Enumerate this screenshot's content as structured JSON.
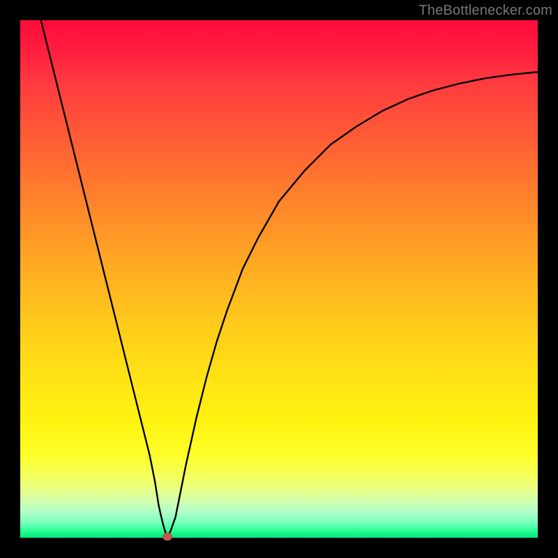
{
  "attribution": "TheBottlenecker.com",
  "colors": {
    "background": "#000000",
    "curve_stroke": "#000000",
    "marker_fill": "#c55a4a"
  },
  "chart_data": {
    "type": "line",
    "title": "",
    "xlabel": "",
    "ylabel": "",
    "xlim": [
      0,
      100
    ],
    "ylim": [
      0,
      100
    ],
    "legend": false,
    "grid": false,
    "series": [
      {
        "name": "bottleneck-curve",
        "x": [
          4,
          6,
          8,
          10,
          12,
          14,
          16,
          18,
          20,
          22,
          23,
          24,
          25,
          26,
          26.8,
          27.5,
          28,
          28.5,
          29,
          30,
          31,
          32,
          34,
          36,
          38,
          40,
          43,
          46,
          50,
          55,
          60,
          65,
          70,
          75,
          80,
          85,
          90,
          95,
          100
        ],
        "y": [
          100,
          92,
          84,
          76,
          68,
          60,
          52,
          44,
          36,
          28,
          24,
          20,
          16,
          11,
          6,
          3,
          1.2,
          0.3,
          1.2,
          4,
          9,
          14,
          23,
          31,
          38,
          44,
          52,
          58,
          65,
          71,
          76,
          79.5,
          82.5,
          84.8,
          86.5,
          87.8,
          88.8,
          89.5,
          90
        ]
      }
    ],
    "annotations": [
      {
        "name": "minimum-marker",
        "x": 28.5,
        "y": 0.3
      }
    ]
  }
}
